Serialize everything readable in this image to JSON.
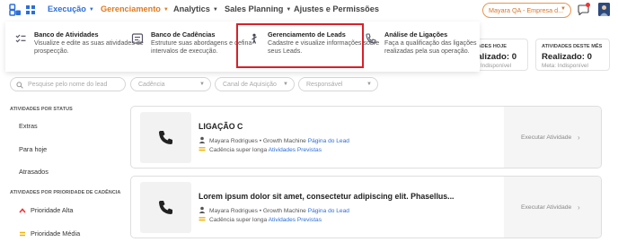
{
  "colors": {
    "accent": "#2d6fd8",
    "orange": "#e07a1f",
    "highlight": "#d8202b"
  },
  "nav": {
    "items": [
      {
        "label": "Execução",
        "active": true,
        "has_caret": true
      },
      {
        "label": "Gerenciamento",
        "orange": true,
        "has_caret": true
      },
      {
        "label": "Analytics",
        "has_caret": true
      },
      {
        "label": "Sales Planning",
        "has_caret": true
      },
      {
        "label": "Ajustes e Permissões",
        "has_caret": false
      }
    ],
    "account": "Mayara QA - Empresa d..."
  },
  "dropdown": {
    "items": [
      {
        "title": "Banco de Atividades",
        "desc": "Visualize e edite as suas atividades de prospecção.",
        "icon": "checklist-icon"
      },
      {
        "title": "Banco de Cadências",
        "desc": "Estruture suas abordagens e defina intervalos de execução.",
        "icon": "cadence-icon"
      },
      {
        "title": "Gerenciamento de Leads",
        "desc": "Cadastre e visualize informações sobre seus Leads.",
        "icon": "leads-icon"
      },
      {
        "title": "Análise de Ligações",
        "desc": "Faça a qualificação das ligações realizadas pela sua operação.",
        "icon": "phone-icon"
      }
    ]
  },
  "stats": [
    {
      "label": "IDADES HOJE",
      "value": "ealizado: 0",
      "meta": "ta: Indisponível"
    },
    {
      "label": "ATIVIDADES DESTE MÊS",
      "value": "Realizado: 0",
      "meta": "Meta: Indisponível"
    }
  ],
  "filters": {
    "search_placeholder": "Pesquise pelo nome do lead",
    "cadence": "Cadência",
    "channel": "Canal de Aquisição",
    "responsible": "Responsável"
  },
  "sidebar": {
    "status_heading": "ATIVIDADES POR STATUS",
    "status_items": [
      "Extras",
      "Para hoje",
      "Atrasados"
    ],
    "priority_heading": "ATIVIDADES POR PRIORIDADE DE CADÊNCIA",
    "priority_items": [
      {
        "label": "Prioridade Alta",
        "icon": "priority-high-icon"
      },
      {
        "label": "Prioridade Média",
        "icon": "priority-medium-icon"
      }
    ]
  },
  "cards": [
    {
      "title": "LIGAÇÃO C",
      "owner": "Mayara Rodrigues • Growth Machine",
      "lead_link": "Página do Lead",
      "cadence": "Cadência super longa",
      "activities_link": "Atividades Previstas",
      "action": "Executar Atividade"
    },
    {
      "title": "Lorem ipsum dolor sit amet, consectetur adipiscing elit. Phasellus...",
      "owner": "Mayara Rodrigues • Growth Machine",
      "lead_link": "Página do Lead",
      "cadence": "Cadência super longa",
      "activities_link": "Atividades Previstas",
      "action": "Executar Atividade"
    }
  ]
}
